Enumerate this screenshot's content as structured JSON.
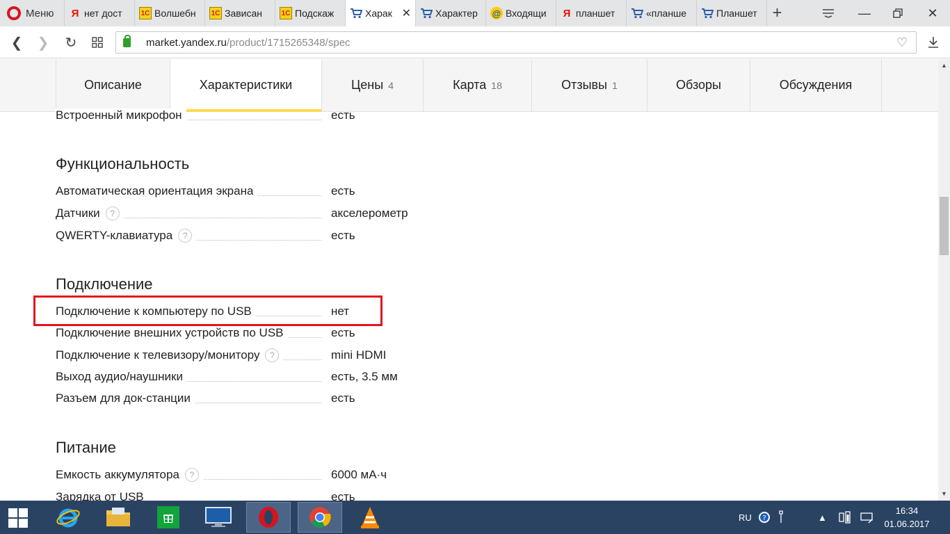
{
  "browser": {
    "menu_label": "Меню",
    "tabs": [
      {
        "icon": "yandex-icon",
        "title": "нет дост"
      },
      {
        "icon": "1c-icon",
        "title": "Волшебн"
      },
      {
        "icon": "1c-icon",
        "title": "Зависан"
      },
      {
        "icon": "1c-icon",
        "title": "Подскаж"
      },
      {
        "icon": "market-cart-icon",
        "title": "Харак",
        "active": true
      },
      {
        "icon": "market-cart-icon",
        "title": "Характер"
      },
      {
        "icon": "mail-icon",
        "title": "Входящи"
      },
      {
        "icon": "yandex-icon",
        "title": "планшет"
      },
      {
        "icon": "market-cart-icon",
        "title": "«планше"
      },
      {
        "icon": "market-cart-icon",
        "title": "Планшет"
      }
    ],
    "url_host": "market.yandex.ru",
    "url_path": "/product/1715265348/spec"
  },
  "product_nav": {
    "tabs": [
      {
        "label": "Описание",
        "count": ""
      },
      {
        "label": "Характеристики",
        "count": "",
        "active": true
      },
      {
        "label": "Цены",
        "count": "4"
      },
      {
        "label": "Карта",
        "count": "18"
      },
      {
        "label": "Отзывы",
        "count": "1"
      },
      {
        "label": "Обзоры",
        "count": ""
      },
      {
        "label": "Обсуждения",
        "count": ""
      }
    ]
  },
  "spec": {
    "top_row": {
      "name": "Встроенный микрофон",
      "value": "есть"
    },
    "functionality": {
      "title": "Функциональность",
      "rows": [
        {
          "name": "Автоматическая ориентация экрана",
          "value": "есть",
          "help": false
        },
        {
          "name": "Датчики",
          "value": "акселерометр",
          "help": true
        },
        {
          "name": "QWERTY-клавиатура",
          "value": "есть",
          "help": true
        }
      ]
    },
    "connection": {
      "title": "Подключение",
      "rows": [
        {
          "name": "Подключение к компьютеру по USB",
          "value": "нет",
          "help": false,
          "highlighted": true
        },
        {
          "name": "Подключение внешних устройств по USB",
          "value": "есть",
          "help": false
        },
        {
          "name": "Подключение к телевизору/монитору",
          "value": "mini HDMI",
          "help": true
        },
        {
          "name": "Выход аудио/наушники",
          "value": "есть, 3.5 мм",
          "help": false
        },
        {
          "name": "Разъем для док-станции",
          "value": "есть",
          "help": false
        }
      ]
    },
    "power": {
      "title": "Питание",
      "rows": [
        {
          "name": "Емкость аккумулятора",
          "value": "6000 мА·ч",
          "help": true
        },
        {
          "name": "Зарядка от USB",
          "value": "есть",
          "help": false
        }
      ]
    }
  },
  "taskbar": {
    "lang": "RU",
    "time": "16:34",
    "date": "01.06.2017"
  },
  "colors": {
    "highlight_box": "#e2151e",
    "active_tab_underline": "#ffdb4d",
    "taskbar": "#2a4363"
  }
}
